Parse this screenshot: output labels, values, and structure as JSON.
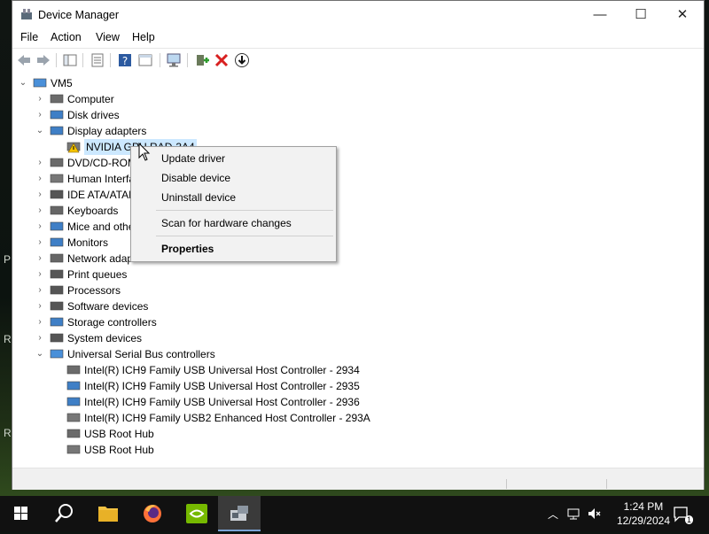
{
  "window": {
    "title": "Device Manager"
  },
  "menu": [
    "File",
    "Action",
    "View",
    "Help"
  ],
  "tree": {
    "root": "VM5",
    "items": [
      {
        "label": "Computer"
      },
      {
        "label": "Disk drives"
      },
      {
        "label": "Display adapters"
      },
      {
        "label": "NVIDIA GPU RAD-3A4",
        "child": true
      },
      {
        "label": "DVD/CD-ROM drives"
      },
      {
        "label": "Human Interface Devices"
      },
      {
        "label": "IDE ATA/ATAPI controllers"
      },
      {
        "label": "Keyboards"
      },
      {
        "label": "Mice and other pointing devices"
      },
      {
        "label": "Monitors"
      },
      {
        "label": "Network adapters"
      },
      {
        "label": "Print queues"
      },
      {
        "label": "Processors"
      },
      {
        "label": "Software devices"
      },
      {
        "label": "Storage controllers"
      },
      {
        "label": "System devices"
      },
      {
        "label": "Universal Serial Bus controllers"
      },
      {
        "label": "Intel(R) ICH9 Family USB Universal Host Controller - 2934",
        "child": true
      },
      {
        "label": "Intel(R) ICH9 Family USB Universal Host Controller - 2935",
        "child": true
      },
      {
        "label": "Intel(R) ICH9 Family USB Universal Host Controller - 2936",
        "child": true
      },
      {
        "label": "Intel(R) ICH9 Family USB2 Enhanced Host Controller - 293A",
        "child": true
      },
      {
        "label": "USB Root Hub",
        "child": true
      },
      {
        "label": "USB Root Hub",
        "child": true
      }
    ]
  },
  "context_menu": {
    "update": "Update driver",
    "disable": "Disable device",
    "uninstall": "Uninstall device",
    "scan": "Scan for hardware changes",
    "properties": "Properties"
  },
  "taskbar": {
    "time": "1:24 PM",
    "date": "12/29/2024",
    "notifications": "1"
  },
  "desktop_letters": [
    "P",
    "R",
    "Re"
  ]
}
